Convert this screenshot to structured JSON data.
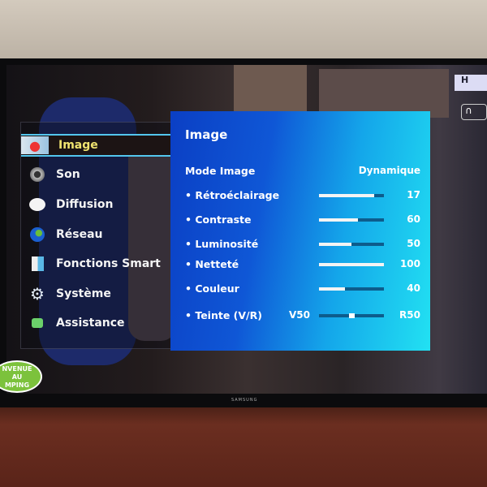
{
  "tv_brand": "SAMSUNG",
  "logo_text": "NVENUE AU MPING",
  "top_right": {
    "badge": "H",
    "icon": "headphones-icon"
  },
  "sidebar": {
    "items": [
      {
        "label": "Image",
        "icon": "picture-balloon-icon",
        "selected": true
      },
      {
        "label": "Son",
        "icon": "speaker-icon"
      },
      {
        "label": "Diffusion",
        "icon": "broadcast-icon"
      },
      {
        "label": "Réseau",
        "icon": "globe-icon"
      },
      {
        "label": "Fonctions Smart",
        "icon": "smart-cube-icon"
      },
      {
        "label": "Système",
        "icon": "gear-icon"
      },
      {
        "label": "Assistance",
        "icon": "chat-bubble-icon"
      }
    ]
  },
  "panel": {
    "title": "Image",
    "mode": {
      "label": "Mode Image",
      "value": "Dynamique"
    },
    "settings": [
      {
        "label": "• Rétroéclairage",
        "value": "17",
        "level": 0.85
      },
      {
        "label": "• Contraste",
        "value": "60",
        "level": 0.6
      },
      {
        "label": "• Luminosité",
        "value": "50",
        "level": 0.5
      },
      {
        "label": "• Netteté",
        "value": "100",
        "level": 1.0
      },
      {
        "label": "• Couleur",
        "value": "40",
        "level": 0.4
      }
    ],
    "tint": {
      "label": "• Teinte (V/R)",
      "left": "V50",
      "right": "R50",
      "level": 0.5
    }
  },
  "colors": {
    "accent": "#53c6ee",
    "selected_text": "#f0e370",
    "panel_blue": "#0f57d6",
    "panel_cyan": "#22e1f2"
  }
}
